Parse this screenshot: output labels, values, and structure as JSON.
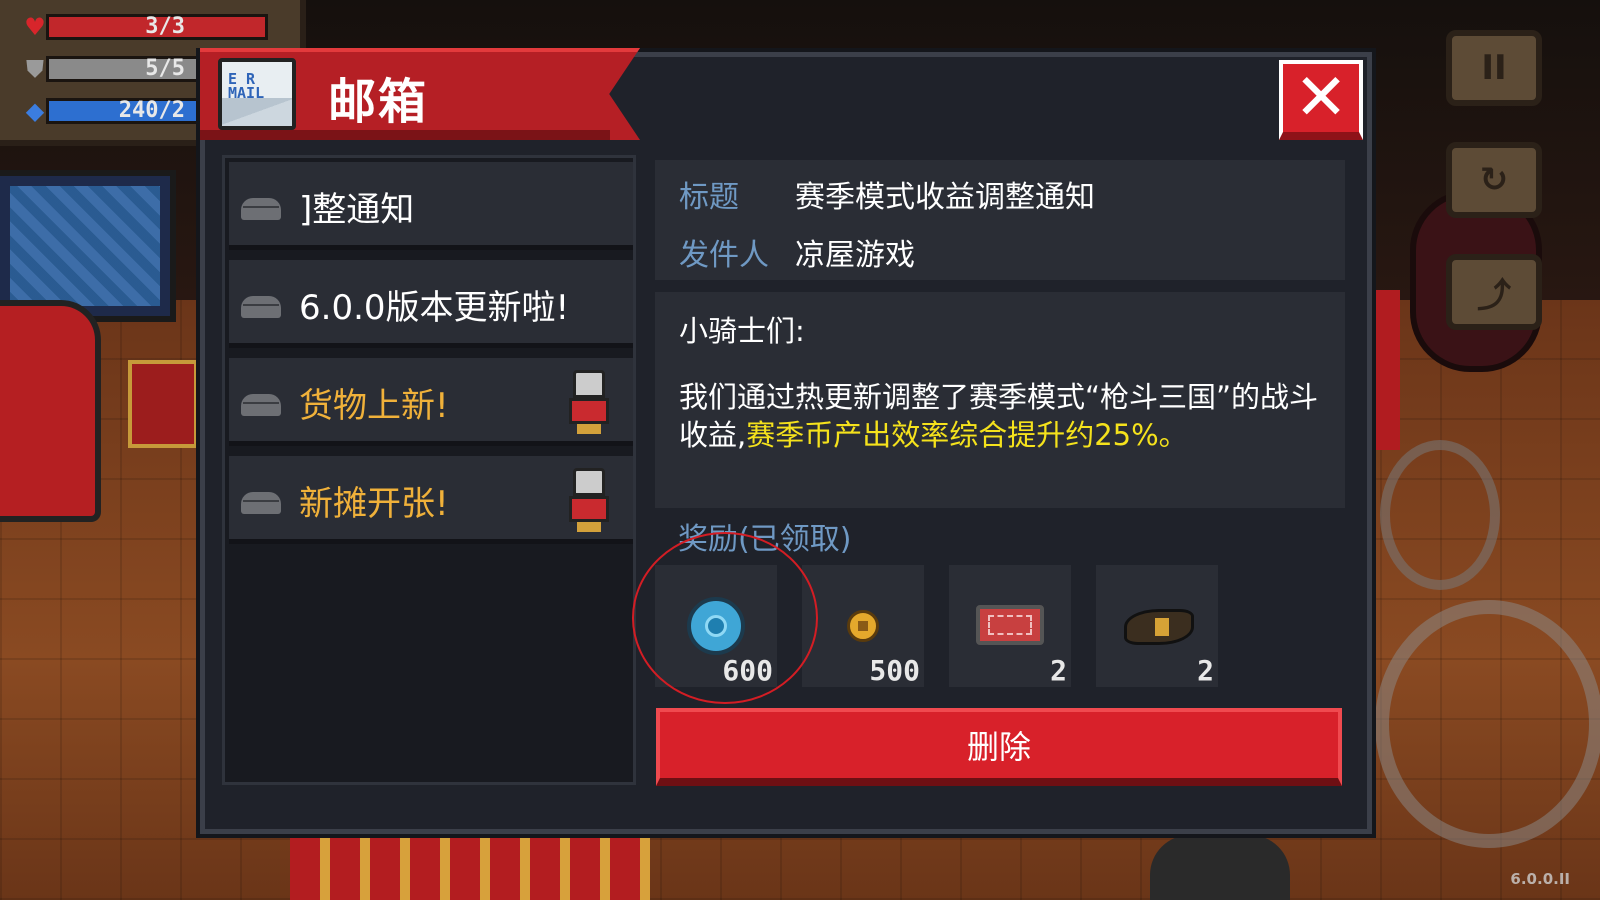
{
  "hud": {
    "hp": "3/3",
    "armor": "5/5",
    "mana": "240/2"
  },
  "right_buttons": {
    "pause": "II",
    "refresh": "↻",
    "exit": "⤴"
  },
  "mailbox": {
    "title": "邮箱",
    "icon_text": "E R\nMAIL",
    "mails": [
      {
        "label": "]整通知",
        "highlight": false,
        "has_avatar": false
      },
      {
        "label": "6.0.0版本更新啦!",
        "highlight": false,
        "has_avatar": false
      },
      {
        "label": "货物上新!",
        "highlight": true,
        "has_avatar": true
      },
      {
        "label": "新摊开张!",
        "highlight": true,
        "has_avatar": true
      }
    ],
    "detail": {
      "title_key": "标题",
      "title_value": "赛季模式收益调整通知",
      "sender_key": "发件人",
      "sender_value": "凉屋游戏",
      "greeting": "小骑士们:",
      "body_part1": "我们通过热更新调整了赛季模式“枪斗三国”的战斗收益,",
      "body_highlight": "赛季币产出效率综合提升约25%。"
    },
    "reward_title": "奖励(已领取)",
    "rewards": [
      {
        "icon": "gem-icon",
        "count": "600"
      },
      {
        "icon": "coin-icon",
        "count": "500"
      },
      {
        "icon": "ticket-icon",
        "count": "2"
      },
      {
        "icon": "fish-icon",
        "count": "2"
      }
    ],
    "delete_label": "删除"
  },
  "version": "6.0.0.II"
}
